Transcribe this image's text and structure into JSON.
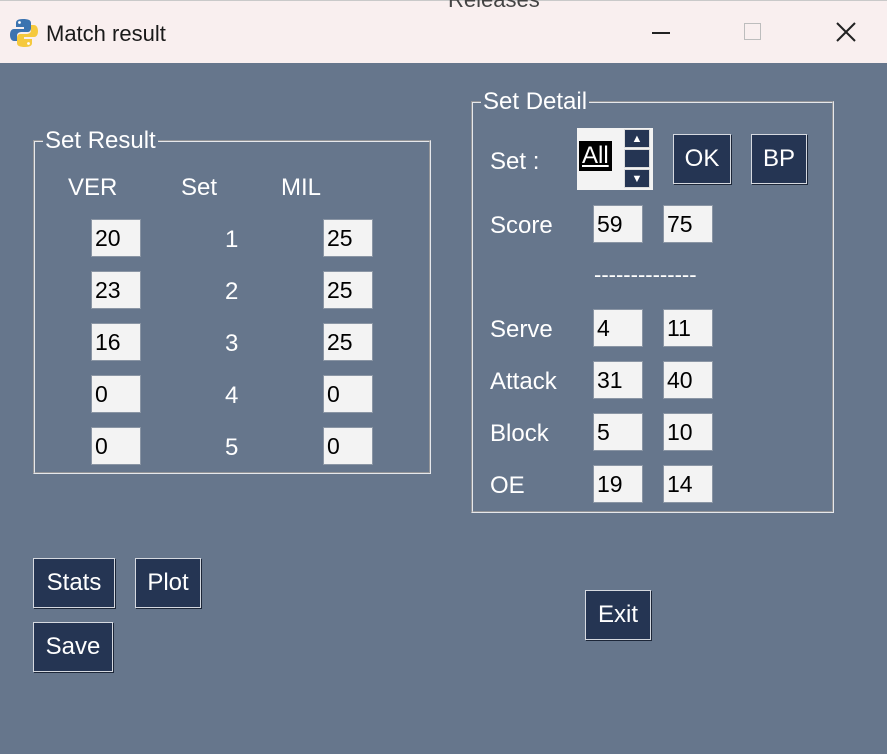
{
  "window": {
    "title": "Match result",
    "background_text": "Releases",
    "controls": {
      "minimize": "—",
      "maximize": "☐",
      "close": "✕"
    },
    "colors": {
      "background": "#66768c",
      "button": "#253553",
      "titlebar": "#f9efef"
    }
  },
  "set_result": {
    "legend": "Set Result",
    "headers": {
      "left": "VER",
      "middle": "Set",
      "right": "MIL"
    },
    "rows": [
      {
        "ver": "20",
        "set": "1",
        "mil": "25"
      },
      {
        "ver": "23",
        "set": "2",
        "mil": "25"
      },
      {
        "ver": "16",
        "set": "3",
        "mil": "25"
      },
      {
        "ver": "0",
        "set": "4",
        "mil": "0"
      },
      {
        "ver": "0",
        "set": "5",
        "mil": "0"
      }
    ]
  },
  "set_detail": {
    "legend": "Set Detail",
    "set_label": "Set :",
    "set_value": "All",
    "ok_label": "OK",
    "bp_label": "BP",
    "score_label": "Score",
    "score_left": "59",
    "score_right": "75",
    "separator": "--------------",
    "stats": [
      {
        "label": "Serve",
        "left": "4",
        "right": "11"
      },
      {
        "label": "Attack",
        "left": "31",
        "right": "40"
      },
      {
        "label": "Block",
        "left": "5",
        "right": "10"
      },
      {
        "label": "OE",
        "left": "19",
        "right": "14"
      }
    ]
  },
  "buttons": {
    "stats": "Stats",
    "plot": "Plot",
    "save": "Save",
    "exit": "Exit"
  }
}
